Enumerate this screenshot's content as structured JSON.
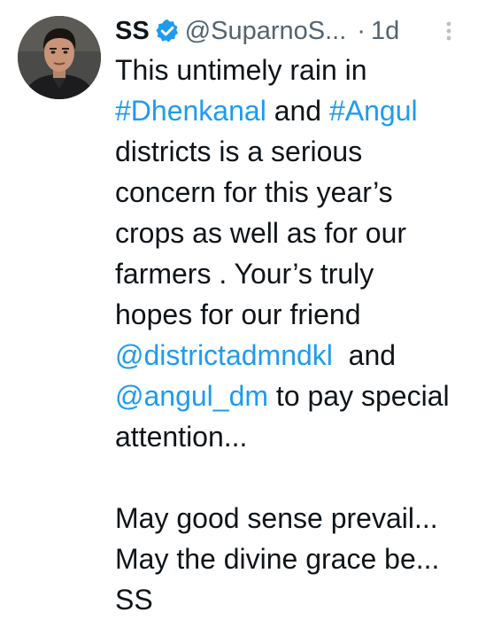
{
  "tweet": {
    "display_name": "SS",
    "handle": "@SuparnoS...",
    "separator": "·",
    "timestamp": "1d",
    "avatar_icon": "person-avatar",
    "verified_icon": "verified-badge-icon",
    "more_icon": "more-options-icon",
    "colors": {
      "link": "#1d9bf0",
      "text": "#0f1419",
      "secondary": "#536471",
      "verified": "#1d9bf0"
    },
    "body": {
      "l1": "This untimely rain in",
      "l2_tag1": "#Dhenkanal",
      "l2_mid": " and ",
      "l2_tag2": "#Angul",
      "l3": "districts is a serious",
      "l4": "concern for this year’s",
      "l5": "crops as well as for our",
      "l6": "farmers . Your’s truly",
      "l7": "hopes for our friend",
      "l8_mention": "@districtadmndkl",
      "l8_rest": "  and",
      "l9_mention": "@angul_dm",
      "l9_rest": " to pay special",
      "l10": "attention...",
      "l11": "May good sense prevail...",
      "l12": "May the divine grace be...",
      "l13": "SS"
    }
  }
}
